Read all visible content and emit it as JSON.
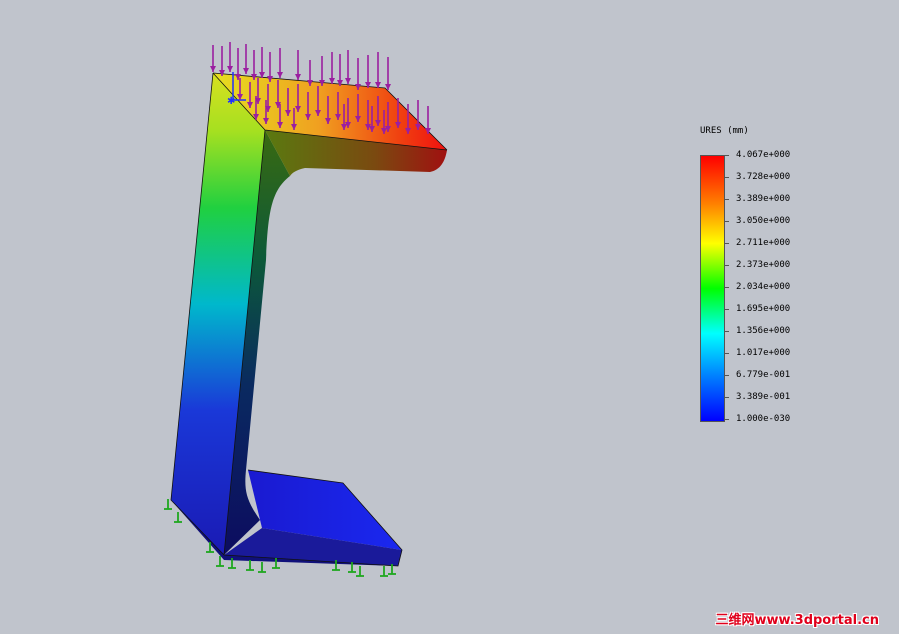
{
  "viewport": {
    "result_label": "URES (mm)",
    "legend_values": [
      "4.067e+000",
      "3.728e+000",
      "3.389e+000",
      "3.050e+000",
      "2.711e+000",
      "2.373e+000",
      "2.034e+000",
      "1.695e+000",
      "1.356e+000",
      "1.017e+000",
      "6.779e-001",
      "3.389e-001",
      "1.000e-030"
    ],
    "colormap": [
      "#ff0000",
      "#ff8000",
      "#ffff00",
      "#00ff00",
      "#00ffff",
      "#0080ff",
      "#0000ff"
    ],
    "load_arrow_color": "#9a1fa0",
    "fixture_color": "#1fa81f",
    "background_color": "#c0c4cc",
    "watermark": "三维网www.3dportal.cn"
  }
}
